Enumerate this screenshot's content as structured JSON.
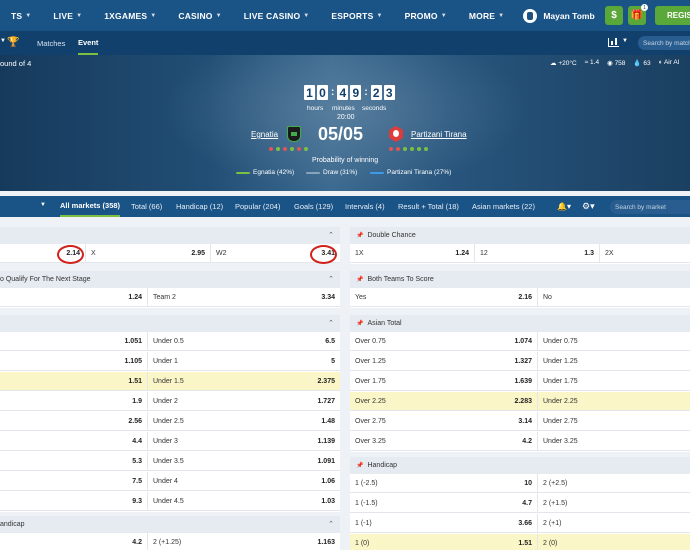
{
  "topnav": {
    "items": [
      "TS",
      "LIVE",
      "1XGAMES",
      "CASINO",
      "LIVE CASINO",
      "ESPORTS",
      "PROMO",
      "MORE"
    ],
    "brand": "Mayan Tomb",
    "wallet_icon": "$",
    "gift_badge": "1",
    "register_label": "REGIS"
  },
  "subnav": {
    "tabs": [
      "Matches",
      "Event"
    ],
    "search_placeholder": "Search by match"
  },
  "hero": {
    "round": "ound of 4",
    "weather": [
      "+20°C",
      "1.4",
      "758",
      "63",
      "Air Al"
    ],
    "timer_digits": [
      "1",
      "0",
      "4",
      "9",
      "2",
      "3"
    ],
    "timer_labels": [
      "hours",
      "minutes",
      "seconds"
    ],
    "kickoff": "20:00",
    "team_home": "Egnatia",
    "team_away": "Partizani Tirana",
    "score": "05/05",
    "prob_title": "Probability of winning",
    "prob": [
      {
        "label": "Egnatia (42%)",
        "color": "#7bc043"
      },
      {
        "label": "Draw (31%)",
        "color": "#8aa3bd"
      },
      {
        "label": "Partizani Tirana (27%)",
        "color": "#3f9be8"
      }
    ],
    "form_home": [
      "#e05555",
      "#7bc043",
      "#e05555",
      "#7bc043",
      "#e05555",
      "#7bc043"
    ],
    "form_away": [
      "#e05555",
      "#e05555",
      "#7bc043",
      "#7bc043",
      "#7bc043",
      "#7bc043"
    ]
  },
  "markets": {
    "tabs": [
      "All markets (358)",
      "Total (66)",
      "Handicap (12)",
      "Popular (204)",
      "Goals (129)",
      "Intervals (4)",
      "Result + Total (18)",
      "Asian markets (22)"
    ],
    "search_placeholder": "Search by market"
  },
  "left": {
    "p1": {
      "cells": [
        [
          "",
          "2.14"
        ],
        [
          "X",
          "2.95"
        ],
        [
          "W2",
          "3.41"
        ]
      ]
    },
    "p2": {
      "title": "o Qualify For The Next Stage",
      "cells": [
        [
          "",
          "1.24"
        ],
        [
          "Team 2",
          "3.34"
        ]
      ]
    },
    "p3": {
      "rows": [
        [
          "",
          "1.051",
          "Under 0.5",
          "6.5"
        ],
        [
          "",
          "1.105",
          "Under 1",
          "5"
        ],
        [
          "",
          "1.51",
          "Under 1.5",
          "2.375"
        ],
        [
          "",
          "1.9",
          "Under 2",
          "1.727"
        ],
        [
          "",
          "2.56",
          "Under 2.5",
          "1.48"
        ],
        [
          "",
          "4.4",
          "Under 3",
          "1.139"
        ],
        [
          "",
          "5.3",
          "Under 3.5",
          "1.091"
        ],
        [
          "",
          "7.5",
          "Under 4",
          "1.06"
        ],
        [
          "",
          "9.3",
          "Under 4.5",
          "1.03"
        ]
      ]
    },
    "p4": {
      "title": "andicap",
      "rows": [
        [
          "",
          "4.2",
          "2 (+1.25)",
          "1.163"
        ]
      ]
    }
  },
  "right": {
    "dc": {
      "title": "Double Chance",
      "cells": [
        [
          "1X",
          "1.24"
        ],
        [
          "12",
          "1.3"
        ],
        [
          "2X",
          ""
        ]
      ]
    },
    "bts": {
      "title": "Both Teams To Score",
      "cells": [
        [
          "Yes",
          "2.16"
        ],
        [
          "No",
          ""
        ]
      ]
    },
    "asian": {
      "title": "Asian Total",
      "rows": [
        [
          "Over 0.75",
          "1.074",
          "Under 0.75"
        ],
        [
          "Over 1.25",
          "1.327",
          "Under 1.25"
        ],
        [
          "Over 1.75",
          "1.639",
          "Under 1.75"
        ],
        [
          "Over 2.25",
          "2.283",
          "Under 2.25"
        ],
        [
          "Over 2.75",
          "3.14",
          "Under 2.75"
        ],
        [
          "Over 3.25",
          "4.2",
          "Under 3.25"
        ]
      ]
    },
    "handicap": {
      "title": "Handicap",
      "rows": [
        [
          "1 (-2.5)",
          "10",
          "2 (+2.5)"
        ],
        [
          "1 (-1.5)",
          "4.7",
          "2 (+1.5)"
        ],
        [
          "1 (-1)",
          "3.66",
          "2 (+1)"
        ],
        [
          "1 (0)",
          "1.51",
          "2 (0)"
        ]
      ]
    }
  }
}
